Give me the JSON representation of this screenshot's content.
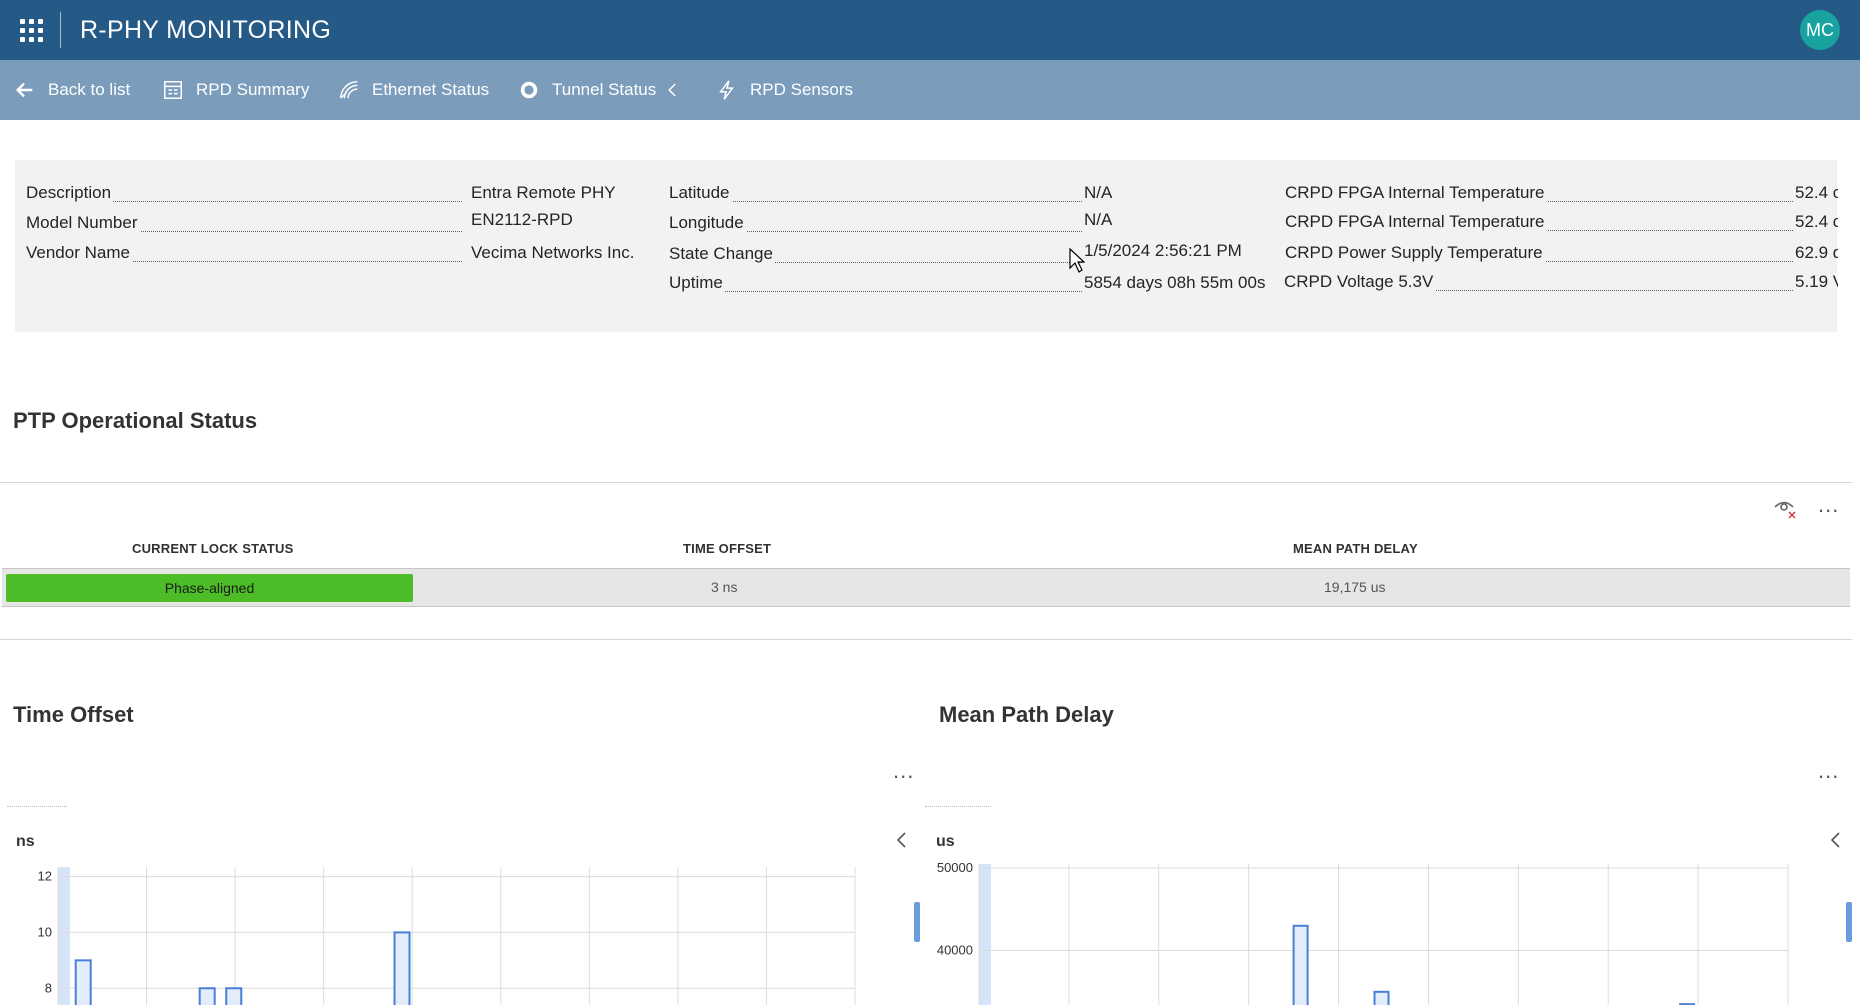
{
  "app": {
    "title": "R-PHY MONITORING",
    "avatar_initials": "MC"
  },
  "commands": [
    {
      "label": "Back to list",
      "icon": "arrow-left-icon"
    },
    {
      "label": "RPD Summary",
      "icon": "summary-grid-icon"
    },
    {
      "label": "Ethernet Status",
      "icon": "ethernet-signal-icon"
    },
    {
      "label": "Tunnel Status",
      "icon": "tunnel-circle-icon"
    },
    {
      "label": "RPD Sensors",
      "icon": "lightning-icon"
    }
  ],
  "info": {
    "col1": [
      {
        "label": "Description",
        "value": "Entra Remote PHY"
      },
      {
        "label": "Model Number",
        "value": "EN2112-RPD"
      },
      {
        "label": "Vendor Name",
        "value": "Vecima Networks Inc."
      }
    ],
    "col2": [
      {
        "label": "Latitude",
        "value": "N/A"
      },
      {
        "label": "Longitude",
        "value": "N/A"
      },
      {
        "label": "State Change",
        "value": "1/5/2024 2:56:21 PM"
      },
      {
        "label": "Uptime",
        "value": "5854 days 08h 55m 00s"
      }
    ],
    "col3": [
      {
        "label": "CRPD FPGA Internal Temperature",
        "value": "52.4 c"
      },
      {
        "label": "CRPD FPGA Internal Temperature",
        "value": "52.4 c"
      },
      {
        "label": "CRPD Power Supply Temperature",
        "value": "62.9 d"
      },
      {
        "label": "CRPD Voltage 5.3V",
        "value": "5.19 V"
      }
    ]
  },
  "ptp": {
    "title": "PTP Operational Status",
    "columns": [
      "CURRENT LOCK STATUS",
      "TIME OFFSET",
      "MEAN PATH DELAY"
    ],
    "row": {
      "lock_status": "Phase-aligned",
      "time_offset": "3 ns",
      "mean_path_delay": "19,175 us"
    },
    "lock_color": "#4cbc27"
  },
  "charts": {
    "more_label": "...",
    "time_offset_title": "Time Offset",
    "mean_path_delay_title": "Mean Path Delay"
  },
  "chart_data": [
    {
      "type": "bar",
      "title": "Time Offset",
      "ylabel": "ns",
      "yticks": [
        8,
        10,
        12
      ],
      "ylim": [
        7.4,
        12.2
      ],
      "x": [
        0.2,
        1.6,
        1.9,
        3.8
      ],
      "values": [
        9,
        8,
        8,
        10
      ],
      "grid": true
    },
    {
      "type": "bar",
      "title": "Mean Path Delay",
      "ylabel": "us",
      "yticks": [
        40000,
        50000
      ],
      "ylim": [
        33400,
        50000
      ],
      "x": [
        3.5,
        4.4,
        7.8
      ],
      "values": [
        43000,
        35000,
        33500
      ],
      "grid": true
    }
  ]
}
